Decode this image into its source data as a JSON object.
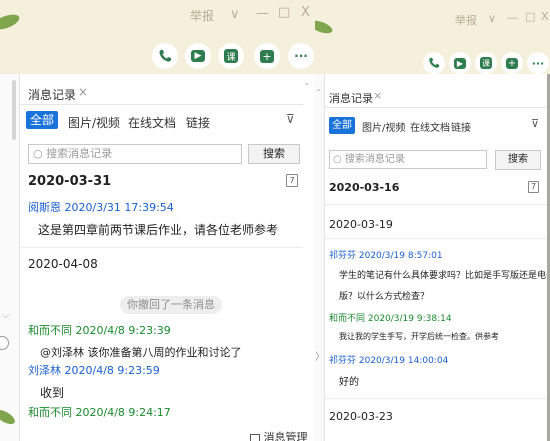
{
  "left": {
    "titlebar": {
      "report": "举报",
      "chevron": "∨",
      "minimize": "—",
      "maximize": "□",
      "close": "X"
    },
    "tab_title": "消息记录",
    "tab_close": "×",
    "filters": [
      "全部",
      "图片/视频",
      "在线文档",
      "链接"
    ],
    "search_placeholder": "搜索消息记录",
    "search_button": "搜索",
    "cal_icon": "7",
    "date1": "2020-03-31",
    "m1_sender": "阅斯恩 2020/3/31 17:39:54",
    "m1_text": "这是第四章前两节课后作业，请各位老师参考",
    "date2": "2020-04-08",
    "recall": "你撤回了一条消息",
    "m2_sender": "和而不同 2020/4/8 9:23:39",
    "m2_text": "@刘泽林 该你准备第八周的作业和讨论了",
    "m3_sender": "刘泽林 2020/4/8 9:23:59",
    "m3_text": "收到",
    "m4_sender": "和而不同 2020/4/8 9:24:17",
    "footer": "消息管理"
  },
  "right": {
    "titlebar": {
      "report": "举报",
      "chevron": "∨",
      "minimize": "—",
      "maximize": "□",
      "close": "X"
    },
    "tab_title": "消息记录",
    "tab_close": "×",
    "filters": [
      "全部",
      "图片/视频",
      "在线文档",
      "链接"
    ],
    "search_placeholder": "搜索消息记录",
    "search_button": "搜索",
    "cal_icon": "7",
    "date1": "2020-03-16",
    "date2": "2020-03-19",
    "m1_sender": "祁芬芬 2020/3/19 8:57:01",
    "m1_line1": "学生的笔记有什么具体要求吗？比如是手写版还是电子",
    "m1_line2": "版？以什么方式检查？",
    "m2_sender": "和而不同 2020/3/19 9:38:14",
    "m2_text": "我让我的学生手写，开学后统一检查。供参考",
    "m3_sender": "祁芬芬 2020/3/19 14:00:04",
    "m3_text": "好的",
    "date3": "2020-03-23"
  },
  "colors": {
    "accent": "#1a73d9",
    "blue_sender": "#1a5fd0",
    "green_sender": "#1a8a2c",
    "app_green": "#2f7d4f"
  }
}
